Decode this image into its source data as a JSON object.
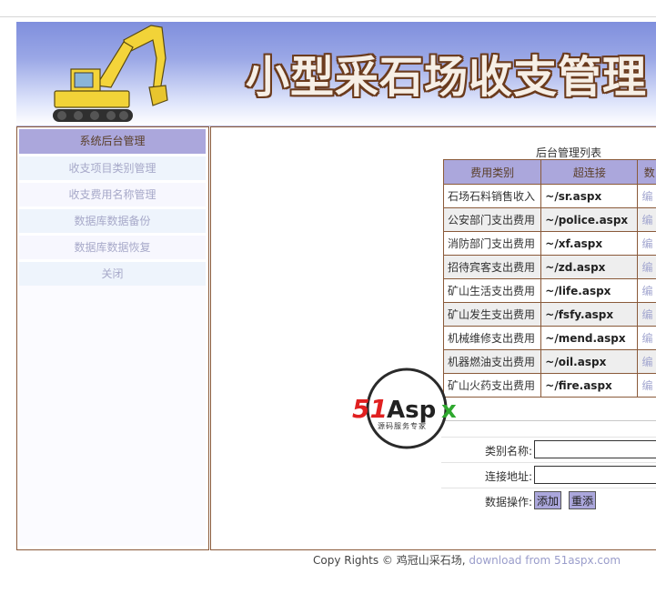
{
  "banner": {
    "title": "小型采石场收支管理"
  },
  "sidebar": {
    "header": "系统后台管理",
    "items": [
      {
        "label": "收支项目类别管理"
      },
      {
        "label": "收支费用名称管理"
      },
      {
        "label": "数据库数据备份"
      },
      {
        "label": "数据库数据恢复"
      },
      {
        "label": "关闭"
      }
    ]
  },
  "main": {
    "list_title": "后台管理列表",
    "columns": [
      "费用类别",
      "超连接",
      "数"
    ],
    "rows": [
      {
        "category": "石场石料销售收入",
        "link": "~/sr.aspx",
        "action": "编"
      },
      {
        "category": "公安部门支出费用",
        "link": "~/police.aspx",
        "action": "编"
      },
      {
        "category": "消防部门支出费用",
        "link": "~/xf.aspx",
        "action": "编"
      },
      {
        "category": "招待宾客支出费用",
        "link": "~/zd.aspx",
        "action": "编"
      },
      {
        "category": "矿山生活支出费用",
        "link": "~/life.aspx",
        "action": "编"
      },
      {
        "category": "矿山发生支出费用",
        "link": "~/fsfy.aspx",
        "action": "编"
      },
      {
        "category": "机械维修支出费用",
        "link": "~/mend.aspx",
        "action": "编"
      },
      {
        "category": "机器燃油支出费用",
        "link": "~/oil.aspx",
        "action": "编"
      },
      {
        "category": "矿山火药支出费用",
        "link": "~/fire.aspx",
        "action": "编"
      }
    ],
    "form": {
      "category_label": "类别名称:",
      "category_value": "",
      "link_label": "连接地址:",
      "link_value": "",
      "ops_label": "数据操作:",
      "add_button": "添加",
      "reset_button": "重添"
    }
  },
  "watermark": {
    "brand": "51Aspx",
    "tagline": "源码服务专家"
  },
  "footer": {
    "text": "Copy Rights © 鸡冠山采石场,",
    "link": "download from 51aspx.com"
  },
  "colors": {
    "header_bg": "#aba7dc",
    "border": "#8a5a3a",
    "link_muted": "#9a9dcb"
  }
}
